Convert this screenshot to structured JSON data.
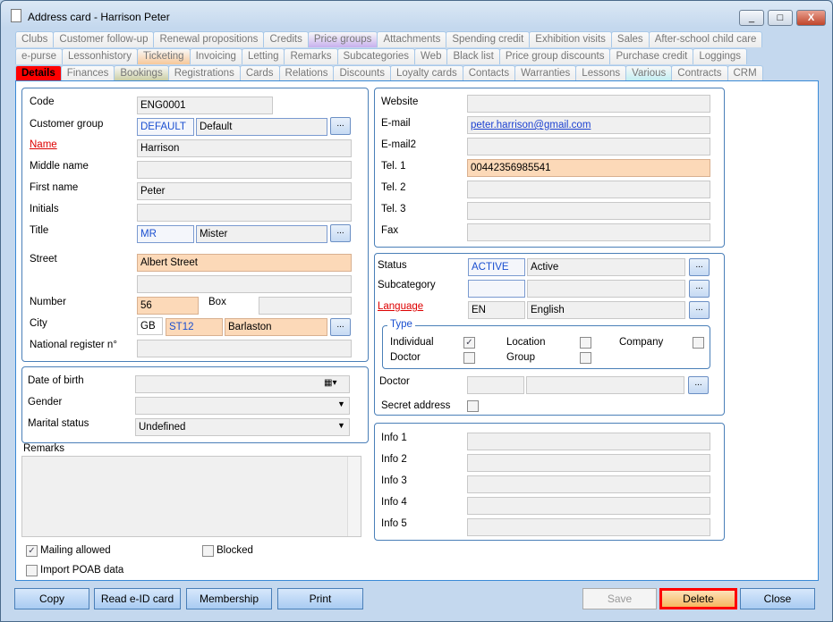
{
  "window": {
    "title": "Address card - Harrison Peter",
    "min": "_",
    "max": "□",
    "close": "X"
  },
  "tabs": {
    "row1": [
      {
        "label": "Clubs"
      },
      {
        "label": "Customer follow-up"
      },
      {
        "label": "Renewal propositions"
      },
      {
        "label": "Credits"
      },
      {
        "label": "Price groups",
        "color": "#c7b0ee"
      },
      {
        "label": "Attachments"
      },
      {
        "label": "Spending credit"
      },
      {
        "label": "Exhibition visits"
      },
      {
        "label": "Sales"
      },
      {
        "label": "After-school child care"
      }
    ],
    "row2": [
      {
        "label": "e-purse"
      },
      {
        "label": "Lessonhistory"
      },
      {
        "label": "Ticketing",
        "color": "#f7c89a"
      },
      {
        "label": "Invoicing"
      },
      {
        "label": "Letting"
      },
      {
        "label": "Remarks"
      },
      {
        "label": "Subcategories"
      },
      {
        "label": "Web"
      },
      {
        "label": "Black list"
      },
      {
        "label": "Price group discounts"
      },
      {
        "label": "Purchase credit"
      },
      {
        "label": "Loggings"
      }
    ],
    "row3": [
      {
        "label": "Details",
        "color": "#ff0000",
        "active": true
      },
      {
        "label": "Finances"
      },
      {
        "label": "Bookings",
        "color": "#c8cca0"
      },
      {
        "label": "Registrations"
      },
      {
        "label": "Cards"
      },
      {
        "label": "Relations"
      },
      {
        "label": "Discounts"
      },
      {
        "label": "Loyalty cards"
      },
      {
        "label": "Contacts"
      },
      {
        "label": "Warranties"
      },
      {
        "label": "Lessons"
      },
      {
        "label": "Various",
        "color": "#bfeef2"
      },
      {
        "label": "Contracts"
      },
      {
        "label": "CRM"
      }
    ]
  },
  "left": {
    "code_l": "Code",
    "code": "ENG0001",
    "group_l": "Customer group",
    "group_code": "DEFAULT",
    "group": "Default",
    "name_l": "Name",
    "name": "Harrison",
    "middle_l": "Middle name",
    "middle": "",
    "first_l": "First name",
    "first": "Peter",
    "initials_l": "Initials",
    "initials": "",
    "title_l": "Title",
    "title_code": "MR",
    "title": "Mister",
    "street_l": "Street",
    "street": "Albert Street",
    "street2": "",
    "number_l": "Number",
    "number": "56",
    "box_l": "Box",
    "box": "",
    "city_l": "City",
    "country": "GB",
    "city_code": "ST12",
    "city": "Barlaston",
    "natreg_l": "National register n°",
    "natreg": "",
    "dob_l": "Date of birth",
    "dob": "",
    "gender_l": "Gender",
    "gender": "",
    "marital_l": "Marital status",
    "marital": "Undefined",
    "remarks_l": "Remarks",
    "remarks": "",
    "ellipsis": "...",
    "mailing": "Mailing allowed",
    "mailing_checked": true,
    "blocked": "Blocked",
    "blocked_checked": false,
    "poab": "Import POAB data",
    "poab_checked": false
  },
  "right": {
    "website_l": "Website",
    "website": "",
    "email_l": "E-mail",
    "email": "peter.harrison@gmail.com",
    "email2_l": "E-mail2",
    "email2": "",
    "tel1_l": "Tel. 1",
    "tel1": "00442356985541",
    "tel2_l": "Tel. 2",
    "tel2": "",
    "tel3_l": "Tel. 3",
    "tel3": "",
    "fax_l": "Fax",
    "fax": "",
    "status_l": "Status",
    "status_code": "ACTIVE",
    "status": "Active",
    "subcat_l": "Subcategory",
    "subcat_code": "",
    "subcat": "",
    "lang_l": "Language",
    "lang_code": "EN",
    "lang": "English",
    "type_l": "Type",
    "individual": "Individual",
    "individual_checked": true,
    "location": "Location",
    "company": "Company",
    "doctor_t": "Doctor",
    "group": "Group",
    "doctor_l": "Doctor",
    "secret_l": "Secret address",
    "info": [
      "Info 1",
      "Info 2",
      "Info 3",
      "Info 4",
      "Info 5"
    ]
  },
  "buttons": {
    "copy": "Copy",
    "eid": "Read e-ID card",
    "membership": "Membership",
    "print": "Print",
    "save": "Save",
    "delete": "Delete",
    "close": "Close"
  }
}
